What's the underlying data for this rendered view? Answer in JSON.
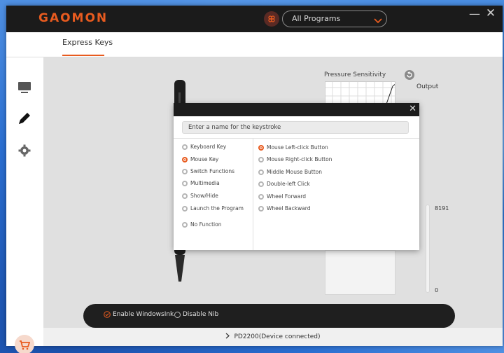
{
  "app": {
    "logo": "GAOMON"
  },
  "header": {
    "program_select": "All Programs",
    "minimize": "—",
    "close": "✕"
  },
  "tabs": [
    {
      "label": "Express Keys"
    }
  ],
  "pressure": {
    "title": "Pressure Sensitivity",
    "output_label": "Output",
    "max": "8191",
    "min": "0"
  },
  "options": {
    "enable_windows_ink": "Enable WindowsInk",
    "disable_nib": "Disable Nib"
  },
  "status": {
    "device": "PD2200(Device connected)"
  },
  "dialog": {
    "close": "✕",
    "input_placeholder": "Enter a name for the keystroke",
    "categories": [
      {
        "label": "Keyboard Key",
        "selected": false
      },
      {
        "label": "Mouse Key",
        "selected": true
      },
      {
        "label": "Switch Functions",
        "selected": false
      },
      {
        "label": "Multimedia",
        "selected": false
      },
      {
        "label": "Show/Hide",
        "selected": false
      },
      {
        "label": "Launch the Program",
        "selected": false
      },
      {
        "label": "No Function",
        "selected": false
      }
    ],
    "mouse_actions": [
      {
        "label": "Mouse Left-click Button",
        "selected": true
      },
      {
        "label": "Mouse Right-click Button",
        "selected": false
      },
      {
        "label": "Middle Mouse Button",
        "selected": false
      },
      {
        "label": "Double-left Click",
        "selected": false
      },
      {
        "label": "Wheel Forward",
        "selected": false
      },
      {
        "label": "Wheel Backward",
        "selected": false
      }
    ]
  },
  "colors": {
    "accent": "#e85b1f",
    "titlebar": "#1b1b1b"
  }
}
